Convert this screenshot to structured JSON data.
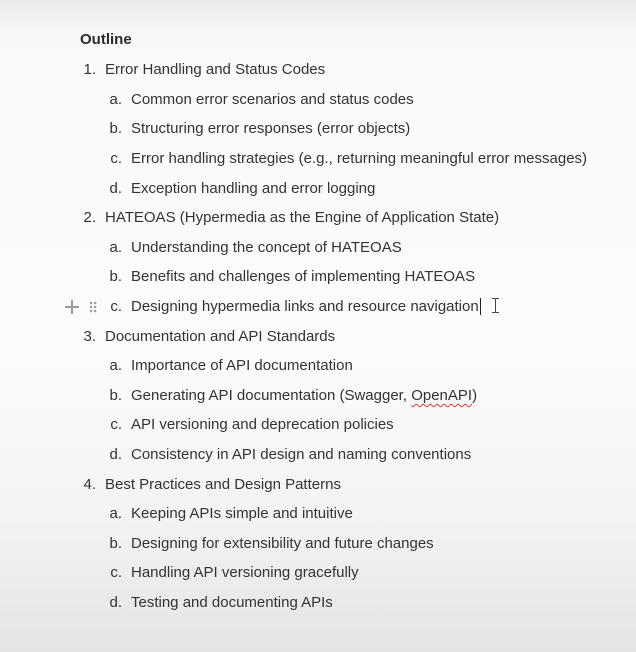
{
  "heading": "Outline",
  "items": [
    {
      "marker": "1.",
      "text": "Error Handling and Status Codes",
      "sub": [
        {
          "marker": "a.",
          "text": "Common error scenarios and status codes"
        },
        {
          "marker": "b.",
          "text": "Structuring error responses (error objects)"
        },
        {
          "marker": "c.",
          "text": "Error handling strategies (e.g., returning meaningful error messages)"
        },
        {
          "marker": "d.",
          "text": "Exception handling and error logging"
        }
      ]
    },
    {
      "marker": "2.",
      "text": "HATEOAS (Hypermedia as the Engine of Application State)",
      "sub": [
        {
          "marker": "a.",
          "text": "Understanding the concept of HATEOAS"
        },
        {
          "marker": "b.",
          "text": "Benefits and challenges of implementing HATEOAS"
        },
        {
          "marker": "c.",
          "text": "Designing hypermedia links and resource navigation"
        }
      ]
    },
    {
      "marker": "3.",
      "text": "Documentation and API Standards",
      "sub": [
        {
          "marker": "a.",
          "text": "Importance of API documentation"
        },
        {
          "marker": "b.",
          "text_before": "Generating API documentation (Swagger, ",
          "text_misspelled": "OpenAPI",
          "text_after": ")"
        },
        {
          "marker": "c.",
          "text": "API versioning and deprecation policies"
        },
        {
          "marker": "d.",
          "text": "Consistency in API design and naming conventions"
        }
      ]
    },
    {
      "marker": "4.",
      "text": "Best Practices and Design Patterns",
      "sub": [
        {
          "marker": "a.",
          "text": "Keeping APIs simple and intuitive"
        },
        {
          "marker": "b.",
          "text": "Designing for extensibility and future changes"
        },
        {
          "marker": "c.",
          "text": "Handling API versioning gracefully"
        },
        {
          "marker": "d.",
          "text": "Testing and documenting APIs"
        }
      ]
    }
  ],
  "icons": {
    "block_add": "plus-icon",
    "block_drag": "drag-handle-icon",
    "mouse_cursor": "text-cursor-icon"
  },
  "colors": {
    "text": "#333333",
    "heading": "#2b2b2b",
    "spellcheck": "#dd3333",
    "handle": "#9a9a9a"
  }
}
